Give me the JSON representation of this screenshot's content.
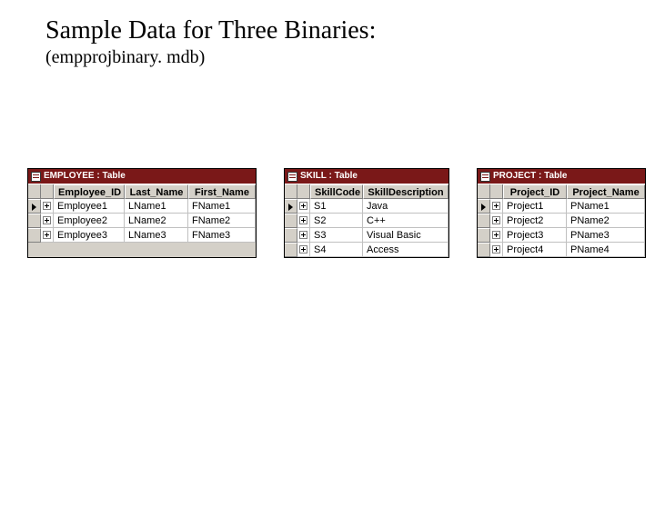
{
  "heading": {
    "title": "Sample Data for Three Binaries:",
    "subtitle": "(empprojbinary. mdb)"
  },
  "tables": {
    "employee": {
      "title": "EMPLOYEE : Table",
      "columns": [
        "Employee_ID",
        "Last_Name",
        "First_Name"
      ],
      "rows": [
        [
          "Employee1",
          "LName1",
          "FName1"
        ],
        [
          "Employee2",
          "LName2",
          "FName2"
        ],
        [
          "Employee3",
          "LName3",
          "FName3"
        ]
      ]
    },
    "skill": {
      "title": "SKILL : Table",
      "columns": [
        "SkillCode",
        "SkillDescription"
      ],
      "rows": [
        [
          "S1",
          "Java"
        ],
        [
          "S2",
          "C++"
        ],
        [
          "S3",
          "Visual Basic"
        ],
        [
          "S4",
          "Access"
        ]
      ]
    },
    "project": {
      "title": "PROJECT : Table",
      "columns": [
        "Project_ID",
        "Project_Name"
      ],
      "rows": [
        [
          "Project1",
          "PName1"
        ],
        [
          "Project2",
          "PName2"
        ],
        [
          "Project3",
          "PName3"
        ],
        [
          "Project4",
          "PName4"
        ]
      ]
    }
  }
}
